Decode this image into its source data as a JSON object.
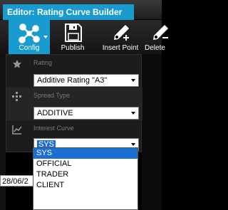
{
  "window": {
    "title": "Editor: Rating Curve Builder"
  },
  "toolbar": {
    "config_label": "Config",
    "publish_label": "Publish",
    "insert_point_label": "Insert Point",
    "delete_label": "Delete",
    "config_icon": "config-nodes-icon",
    "publish_icon": "floppy-disk-icon",
    "insert_point_icon": "pen-add-icon",
    "delete_icon": "pen-remove-icon"
  },
  "config_panel": {
    "rating": {
      "label": "Rating",
      "icon": "star-icon",
      "value": "Additive Rating \"A3\""
    },
    "spread_type": {
      "label": "Spread Type",
      "icon": "plus-cross-icon",
      "value": "ADDITIVE"
    },
    "interest_curve": {
      "label": "Interest Curve",
      "icon": "line-chart-icon",
      "value": "SYS",
      "options": [
        "SYS",
        "OFFICIAL",
        "TRADER",
        "CLIENT"
      ]
    }
  },
  "background": {
    "date_cell": "28/06/2"
  },
  "colors": {
    "accent": "#1a9bd0",
    "selection": "#1a6fd0"
  }
}
